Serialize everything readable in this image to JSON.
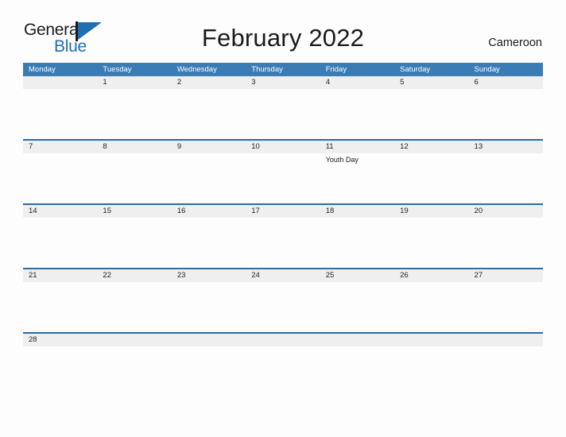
{
  "brand": {
    "name_part1": "General",
    "name_part2": "Blue",
    "logo_icon": "flag-triangle-icon"
  },
  "header": {
    "title": "February 2022",
    "country": "Cameroon"
  },
  "calendar": {
    "weekdays": [
      "Monday",
      "Tuesday",
      "Wednesday",
      "Thursday",
      "Friday",
      "Saturday",
      "Sunday"
    ],
    "accent_color": "#3a7cb5",
    "divider_color": "#2a6ca8",
    "date_band_color": "#efefef",
    "weeks": [
      {
        "days": [
          {
            "number": "",
            "event": ""
          },
          {
            "number": "1",
            "event": ""
          },
          {
            "number": "2",
            "event": ""
          },
          {
            "number": "3",
            "event": ""
          },
          {
            "number": "4",
            "event": ""
          },
          {
            "number": "5",
            "event": ""
          },
          {
            "number": "6",
            "event": ""
          }
        ]
      },
      {
        "days": [
          {
            "number": "7",
            "event": ""
          },
          {
            "number": "8",
            "event": ""
          },
          {
            "number": "9",
            "event": ""
          },
          {
            "number": "10",
            "event": ""
          },
          {
            "number": "11",
            "event": "Youth Day"
          },
          {
            "number": "12",
            "event": ""
          },
          {
            "number": "13",
            "event": ""
          }
        ]
      },
      {
        "days": [
          {
            "number": "14",
            "event": ""
          },
          {
            "number": "15",
            "event": ""
          },
          {
            "number": "16",
            "event": ""
          },
          {
            "number": "17",
            "event": ""
          },
          {
            "number": "18",
            "event": ""
          },
          {
            "number": "19",
            "event": ""
          },
          {
            "number": "20",
            "event": ""
          }
        ]
      },
      {
        "days": [
          {
            "number": "21",
            "event": ""
          },
          {
            "number": "22",
            "event": ""
          },
          {
            "number": "23",
            "event": ""
          },
          {
            "number": "24",
            "event": ""
          },
          {
            "number": "25",
            "event": ""
          },
          {
            "number": "26",
            "event": ""
          },
          {
            "number": "27",
            "event": ""
          }
        ]
      },
      {
        "short": true,
        "days": [
          {
            "number": "28",
            "event": ""
          },
          {
            "number": "",
            "event": ""
          },
          {
            "number": "",
            "event": ""
          },
          {
            "number": "",
            "event": ""
          },
          {
            "number": "",
            "event": ""
          },
          {
            "number": "",
            "event": ""
          },
          {
            "number": "",
            "event": ""
          }
        ]
      }
    ]
  }
}
